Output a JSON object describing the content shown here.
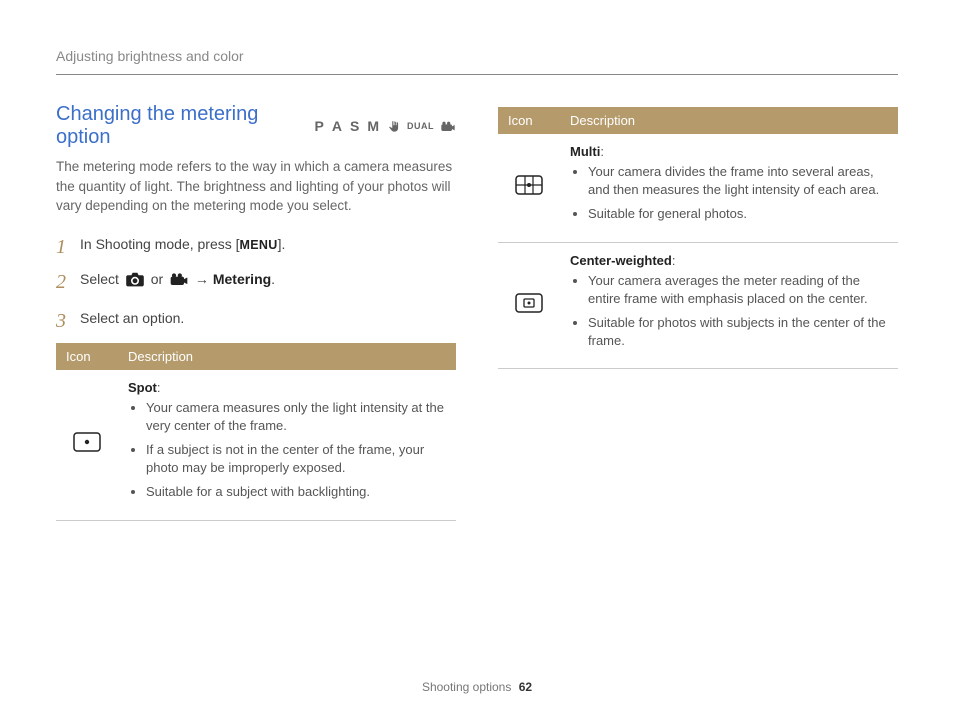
{
  "breadcrumb": "Adjusting brightness and color",
  "heading": "Changing the metering option",
  "modes": {
    "p": "P",
    "a": "A",
    "s": "S",
    "m": "M",
    "dual": "DUAL"
  },
  "intro": "The metering mode refers to the way in which a camera measures the quantity of light. The brightness and lighting of your photos will vary depending on the metering mode you select.",
  "steps": {
    "s1_a": "In Shooting mode, press [",
    "s1_menu": "MENU",
    "s1_b": "].",
    "s2_a": "Select ",
    "s2_b": " or ",
    "s2_c": " → ",
    "s2_metering": "Metering",
    "s2_d": ".",
    "s3": "Select an option."
  },
  "table": {
    "h_icon": "Icon",
    "h_desc": "Description",
    "rows": {
      "spot": {
        "title": "Spot",
        "b1": "Your camera measures only the light intensity at the very center of the frame.",
        "b2": "If a subject is not in the center of the frame, your photo may be improperly exposed.",
        "b3": "Suitable for a subject with backlighting."
      },
      "multi": {
        "title": "Multi",
        "b1": "Your camera divides the frame into several areas, and then measures the light intensity of each area.",
        "b2": "Suitable for general photos."
      },
      "center": {
        "title": "Center-weighted",
        "b1": "Your camera averages the meter reading of the entire frame with emphasis placed on the center.",
        "b2": "Suitable for photos with subjects in the center of the frame."
      }
    }
  },
  "footer": {
    "section": "Shooting options",
    "page": "62"
  }
}
